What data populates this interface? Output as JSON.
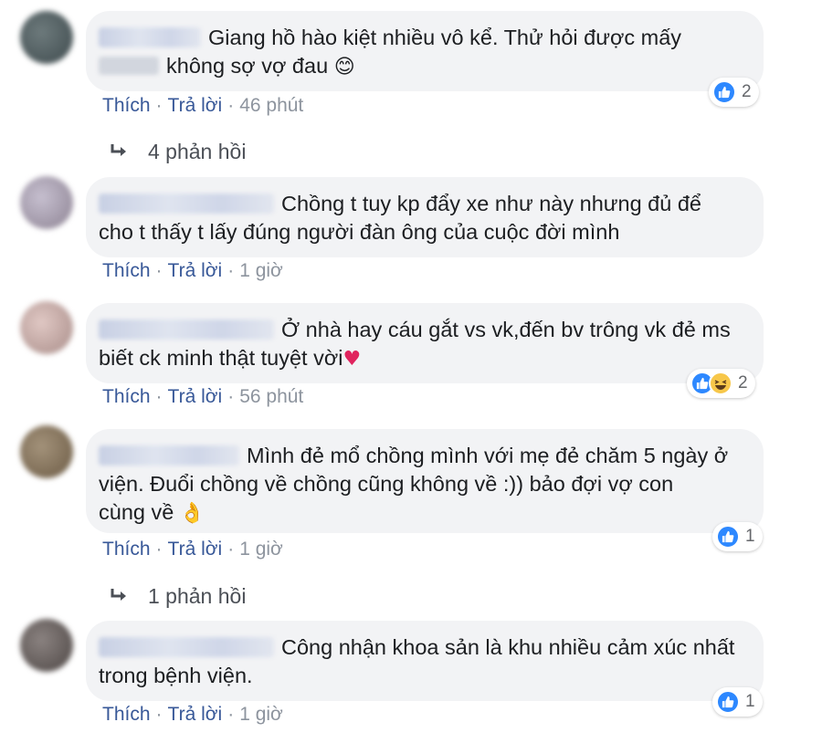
{
  "comments": [
    {
      "line1": "Giang hồ hào kiệt nhiều vô kể. Thử hỏi được mấy",
      "line2": "không sợ vợ đau",
      "emoji": "😊",
      "like": "Thích",
      "reply": "Trả lời",
      "time": "46 phút",
      "reaction_count": "2",
      "reactions": [
        "like-icon"
      ]
    },
    {
      "line1": "Chồng t tuy kp đẩy xe như này nhưng đủ để",
      "line2": "cho t thấy t lấy đúng người đàn ông của cuộc đời mình",
      "like": "Thích",
      "reply": "Trả lời",
      "time": "1 giờ"
    },
    {
      "line1": "Ở nhà hay cáu gắt vs vk,đến bv trông vk đẻ ms",
      "line2": "biết ck minh thật tuyệt vời",
      "emoji": "❤️",
      "like": "Thích",
      "reply": "Trả lời",
      "time": "56 phút",
      "reaction_count": "2",
      "reactions": [
        "like-icon",
        "haha-icon"
      ]
    },
    {
      "line1": "Mình đẻ mổ chồng mình với mẹ đẻ chăm 5 ngày ở",
      "line2": "viện. Đuổi chồng về chồng cũng không về :)) bảo đợi vợ con",
      "line3": "cùng về",
      "emoji": "👌",
      "like": "Thích",
      "reply": "Trả lời",
      "time": "1 giờ",
      "reaction_count": "1",
      "reactions": [
        "like-icon"
      ]
    },
    {
      "line1": "Công nhận khoa sản là khu nhiều cảm xúc nhất",
      "line2": "trong bệnh viện.",
      "like": "Thích",
      "reply": "Trả lời",
      "time": "1 giờ",
      "reaction_count": "1",
      "reactions": [
        "like-icon"
      ]
    }
  ],
  "replies": [
    {
      "label": "4 phản hồi"
    },
    {
      "label": "1 phản hồi"
    }
  ],
  "colors": {
    "bubble": "#f2f3f5",
    "link": "#385898",
    "meta": "#8d949e",
    "like": "#2d88ff"
  }
}
